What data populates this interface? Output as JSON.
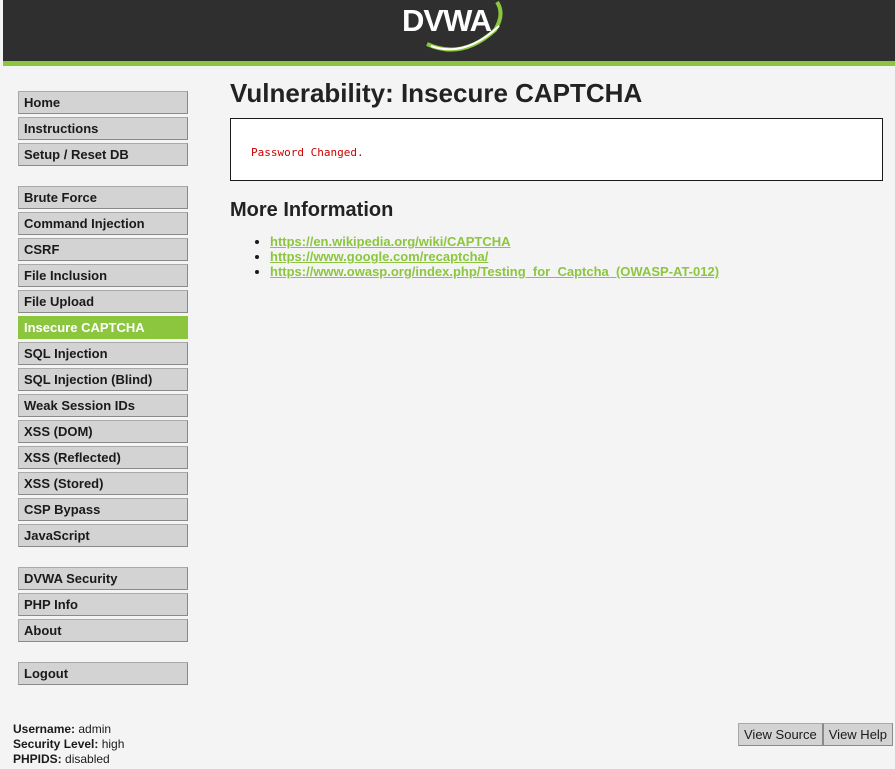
{
  "header": {
    "logo_text": "DVWA",
    "brand_color": "#8cc63f",
    "header_bg": "#2f2f2f"
  },
  "sidebar": {
    "groups": [
      [
        {
          "label": "Home"
        },
        {
          "label": "Instructions"
        },
        {
          "label": "Setup / Reset DB"
        }
      ],
      [
        {
          "label": "Brute Force"
        },
        {
          "label": "Command Injection"
        },
        {
          "label": "CSRF"
        },
        {
          "label": "File Inclusion"
        },
        {
          "label": "File Upload"
        },
        {
          "label": "Insecure CAPTCHA",
          "selected": true
        },
        {
          "label": "SQL Injection"
        },
        {
          "label": "SQL Injection (Blind)"
        },
        {
          "label": "Weak Session IDs"
        },
        {
          "label": "XSS (DOM)"
        },
        {
          "label": "XSS (Reflected)"
        },
        {
          "label": "XSS (Stored)"
        },
        {
          "label": "CSP Bypass"
        },
        {
          "label": "JavaScript"
        }
      ],
      [
        {
          "label": "DVWA Security"
        },
        {
          "label": "PHP Info"
        },
        {
          "label": "About"
        }
      ],
      [
        {
          "label": "Logout"
        }
      ]
    ]
  },
  "main": {
    "title": "Vulnerability: Insecure CAPTCHA",
    "message": "Password Changed.",
    "more_info_title": "More Information",
    "links": [
      "https://en.wikipedia.org/wiki/CAPTCHA",
      "https://www.google.com/recaptcha/",
      "https://www.owasp.org/index.php/Testing_for_Captcha_(OWASP-AT-012)"
    ]
  },
  "status": {
    "username_label": "Username:",
    "username": "admin",
    "security_label": "Security Level:",
    "security": "high",
    "phpids_label": "PHPIDS:",
    "phpids": "disabled"
  },
  "footer": {
    "view_source": "View Source",
    "view_help": "View Help"
  }
}
